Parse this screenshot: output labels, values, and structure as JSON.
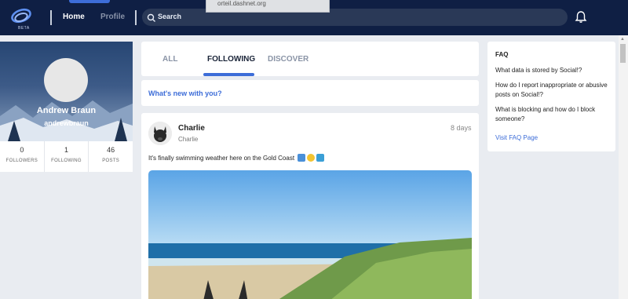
{
  "header": {
    "beta_badge": "BETA",
    "nav": {
      "home_label": "Home",
      "profile_label": "Profile"
    },
    "search": {
      "placeholder": "Search"
    },
    "url_tooltip": "orteil.dashnet.org",
    "icons": {
      "logo": "social-logo-icon",
      "search": "search-icon",
      "notifications": "bell-icon"
    }
  },
  "profile": {
    "name": "Andrew Braun",
    "handle": "andrewbraun",
    "stats": [
      {
        "value": "0",
        "label": "FOLLOWERS"
      },
      {
        "value": "1",
        "label": "FOLLOWING"
      },
      {
        "value": "46",
        "label": "POSTS"
      }
    ]
  },
  "feed": {
    "tabs": [
      {
        "label": "ALL",
        "active": false
      },
      {
        "label": "FOLLOWING",
        "active": true
      },
      {
        "label": "DISCOVER",
        "active": false
      }
    ],
    "composer_prompt": "What's new with you?",
    "post": {
      "author": "Charlie",
      "handle": "Charlie",
      "time": "8 days",
      "text": "It's finally swimming weather here on the Gold Coast",
      "emojis": [
        "swimming-emoji",
        "sun-emoji",
        "wave-emoji"
      ]
    }
  },
  "faq": {
    "title": "FAQ",
    "items": [
      "What data is stored by Social!?",
      "How do I report inappropriate or abusive posts on Social!?",
      "What is blocking and how do I block someone?"
    ],
    "link_label": "Visit FAQ Page"
  },
  "colors": {
    "header_bg": "#0f1f44",
    "accent": "#3d6dd8",
    "page_bg": "#e9ecf1"
  }
}
